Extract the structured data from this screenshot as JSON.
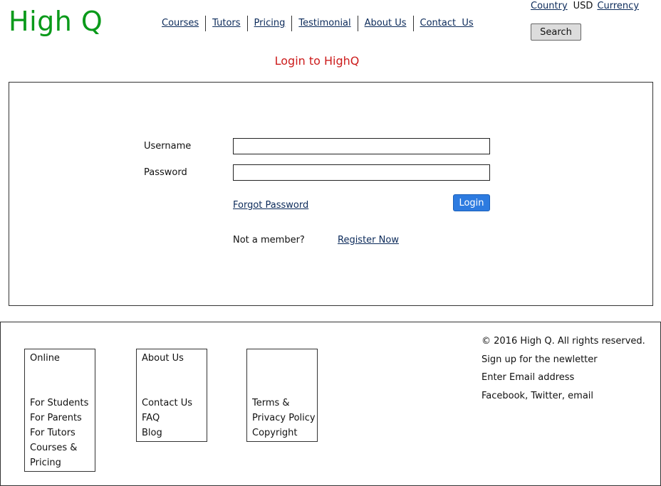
{
  "header": {
    "logo": "High Q",
    "nav": [
      "Courses",
      "Tutors",
      "Pricing",
      "Testimonial",
      "About Us",
      "Contact  Us"
    ],
    "country_link": "Country",
    "currency_value": "USD",
    "currency_link": "Currency",
    "search_label": "Search"
  },
  "page_title": "Login to HighQ",
  "login": {
    "username_label": "Username",
    "username_value": "",
    "password_label": "Password",
    "password_value": "",
    "forgot_link": "Forgot Password",
    "login_button": "Login",
    "not_member_text": "Not a member?",
    "register_link": "Register Now"
  },
  "footer": {
    "col1": {
      "heading": "Online",
      "items": [
        "For Students",
        "For Parents",
        "For Tutors",
        "Courses &",
        "Pricing"
      ]
    },
    "col2": {
      "heading": "About Us",
      "items": [
        "Contact Us",
        "FAQ",
        "Blog"
      ]
    },
    "col3": {
      "heading": "",
      "items": [
        "Terms &",
        "Privacy Policy",
        "Copyright"
      ]
    },
    "right": {
      "copyright": "© 2016 High Q. All rights reserved.",
      "newsletter": "Sign up for the newletter",
      "email_prompt": "Enter Email address",
      "social": "Facebook, Twitter, email"
    }
  }
}
